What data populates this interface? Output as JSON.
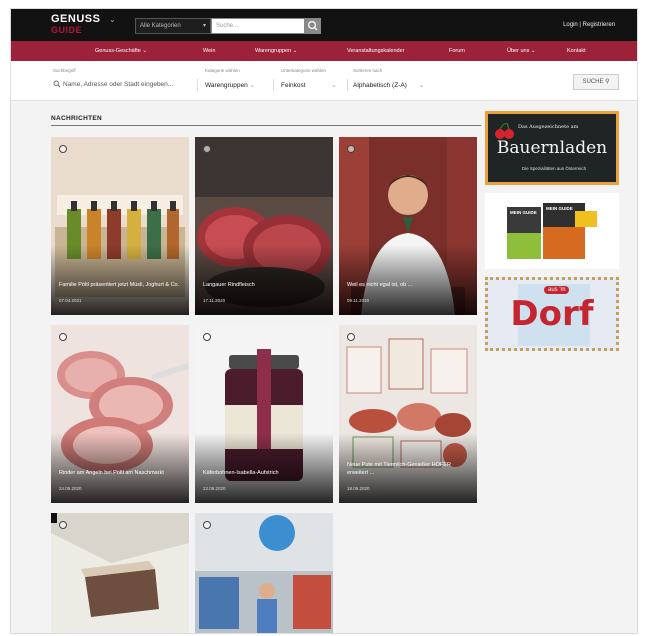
{
  "brand": {
    "line1": "GENUSS",
    "line2": "GUIDE"
  },
  "top_search": {
    "category_label": "Alle Kategorien",
    "placeholder": "Suche..."
  },
  "top_links": {
    "login": "Login | Registrieren"
  },
  "nav": {
    "items": [
      "Genuss-Geschäfte",
      "Wein",
      "Warengruppen",
      "Veranstaltungskalender",
      "Forum",
      "Über uns",
      "Kontakt"
    ]
  },
  "filter": {
    "search_label": "Suchbegriff",
    "search_placeholder": "Name, Adresse oder Stadt eingeben...",
    "group_label": "Kategorie wählen",
    "group_value": "Warengruppen",
    "sub_label": "Unterkategorie wählen",
    "sub_value": "Feinkost",
    "sort_label": "Sortieren nach",
    "sort_value": "Alphabetisch (Z-A)",
    "button": "SUCHE"
  },
  "news": {
    "heading": "NACHRICHTEN",
    "cards": [
      {
        "title": "Familie Pöltl präsentiert jetzt Müsli, Joghurt & Co.",
        "date": "07.04.2021"
      },
      {
        "title": "Langauer Rindfleisch",
        "date": "17.11.2020"
      },
      {
        "title": "Weil es nicht egal ist, ob ...",
        "date": "09.11.2020"
      },
      {
        "title": "Rinder am Angeln bei Pöltl am Naschmarkt",
        "date": "24.09.2020"
      },
      {
        "title": "Käferbohnen-Isabella-Aufstrich",
        "date": "22.09.2020"
      },
      {
        "title": "Neue Pute mit Tiermilch-Genießer HOFER erweitert ...",
        "date": "18.09.2020"
      },
      {
        "title": "",
        "date": ""
      },
      {
        "title": "",
        "date": ""
      }
    ]
  },
  "ads": {
    "bauernladen": {
      "small": "Das Ausgezeichnete am",
      "big": "Bauernladen",
      "sub": "Die Spezialitäten aus Österreich"
    },
    "guide": {
      "badge1": "MEIN GUIDE",
      "badge2": "MEIN GUIDE"
    },
    "dorf": {
      "small": "aus 'm",
      "big": "Dorf"
    }
  },
  "colors": {
    "nav_bg": "#9b2238",
    "top_bg": "#121212",
    "accent": "#b5153b"
  }
}
